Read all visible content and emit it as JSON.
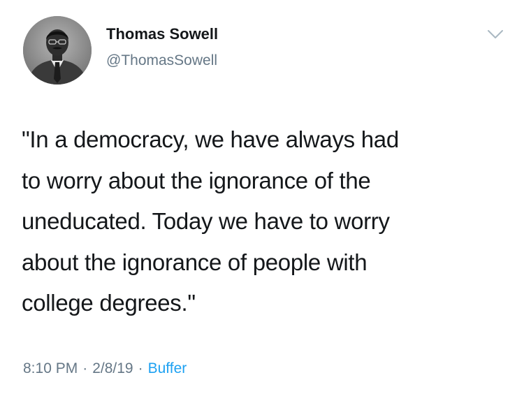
{
  "author": {
    "display_name": "Thomas Sowell",
    "handle": "@ThomasSowell",
    "avatar_icon": "profile-photo"
  },
  "menu_icon": "chevron-down-icon",
  "tweet": {
    "lines": [
      "\"In a democracy, we have always had",
      "to worry about the ignorance of the",
      "uneducated. Today we have to worry",
      "about the ignorance of people with",
      "college degrees.\""
    ]
  },
  "meta": {
    "time": "8:10 PM",
    "separator": "·",
    "date": "2/8/19",
    "source": "Buffer"
  },
  "colors": {
    "text": "#14171a",
    "secondary": "#657786",
    "link": "#1da1f2"
  }
}
